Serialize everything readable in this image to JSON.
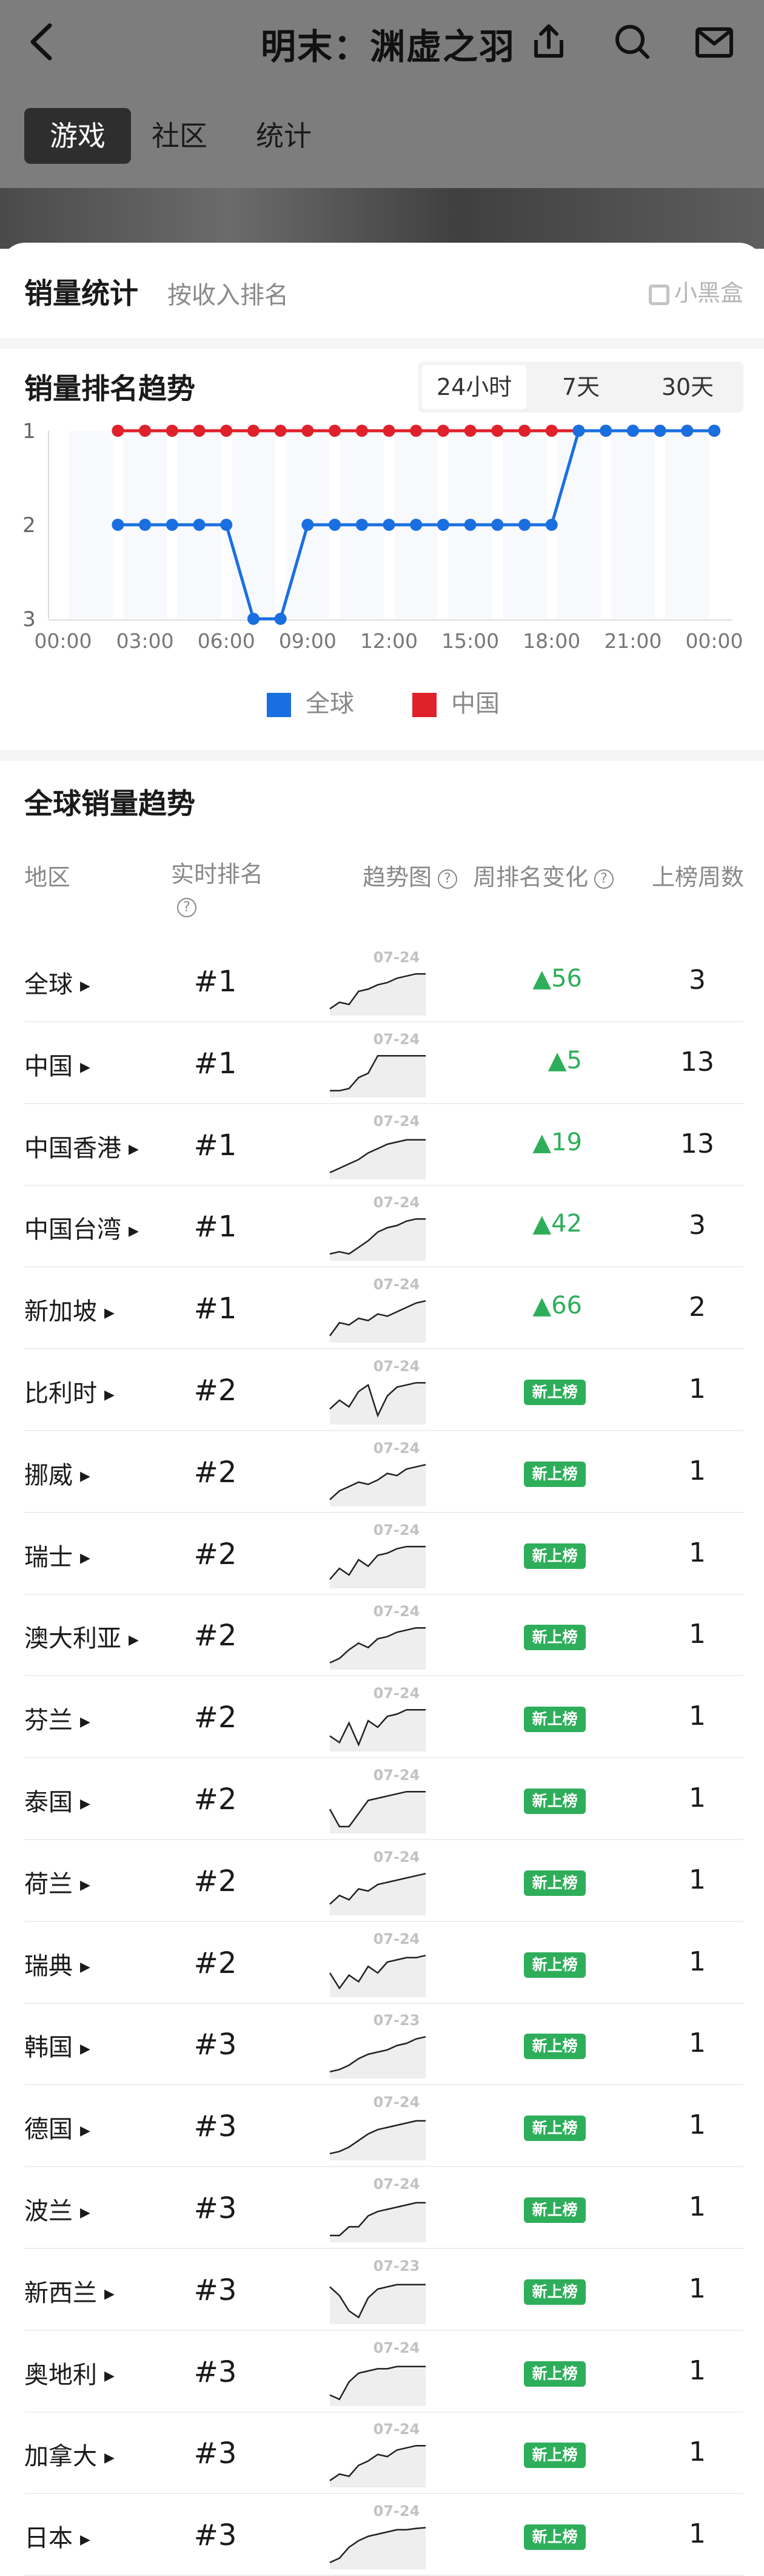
{
  "header": {
    "title": "明末：渊虚之羽",
    "tabs": [
      {
        "label": "游戏"
      },
      {
        "label": "社区"
      },
      {
        "label": "统计"
      }
    ]
  },
  "sales": {
    "title": "销量统计",
    "subtitle": "按收入排名",
    "brand": "小黑盒"
  },
  "trend": {
    "title": "销量排名趋势",
    "ranges": [
      "24小时",
      "7天",
      "30天"
    ],
    "selected": "24小时"
  },
  "chart_data": {
    "type": "line",
    "x": [
      "00:00",
      "01:00",
      "02:00",
      "03:00",
      "04:00",
      "05:00",
      "06:00",
      "07:00",
      "08:00",
      "09:00",
      "10:00",
      "11:00",
      "12:00",
      "13:00",
      "14:00",
      "15:00",
      "16:00",
      "17:00",
      "18:00",
      "19:00",
      "20:00",
      "21:00",
      "22:00",
      "23:00",
      "00:00"
    ],
    "xticks": [
      "00:00",
      "03:00",
      "06:00",
      "09:00",
      "12:00",
      "15:00",
      "18:00",
      "21:00",
      "00:00"
    ],
    "yticks": [
      "1",
      "2",
      "3"
    ],
    "ylim": [
      1,
      3
    ],
    "y_inverted": true,
    "series": [
      {
        "name": "全球",
        "color": "#1a6fe0",
        "values": [
          null,
          null,
          2,
          2,
          2,
          2,
          2,
          3,
          3,
          2,
          2,
          2,
          2,
          2,
          2,
          2,
          2,
          2,
          2,
          1,
          1,
          1,
          1,
          1,
          1
        ]
      },
      {
        "name": "中国",
        "color": "#e0202a",
        "values": [
          null,
          null,
          1,
          1,
          1,
          1,
          1,
          1,
          1,
          1,
          1,
          1,
          1,
          1,
          1,
          1,
          1,
          1,
          1,
          1,
          1,
          1,
          1,
          1,
          1
        ]
      }
    ],
    "grid": false,
    "legend": "bottom-center"
  },
  "global": {
    "title": "全球销量趋势",
    "headers": {
      "region": "地区",
      "rank": "实时排名",
      "trend": "趋势图",
      "change": "周排名变化",
      "weeks": "上榜周数"
    },
    "new_label": "新上榜",
    "rows": [
      {
        "region": "全球",
        "rank": "#1",
        "date": "07-24",
        "change": "▲56",
        "weeks": "3",
        "new": false
      },
      {
        "region": "中国",
        "rank": "#1",
        "date": "07-24",
        "change": "▲5",
        "weeks": "13",
        "new": false
      },
      {
        "region": "中国香港",
        "rank": "#1",
        "date": "07-24",
        "change": "▲19",
        "weeks": "13",
        "new": false
      },
      {
        "region": "中国台湾",
        "rank": "#1",
        "date": "07-24",
        "change": "▲42",
        "weeks": "3",
        "new": false
      },
      {
        "region": "新加坡",
        "rank": "#1",
        "date": "07-24",
        "change": "▲66",
        "weeks": "2",
        "new": false
      },
      {
        "region": "比利时",
        "rank": "#2",
        "date": "07-24",
        "change": "",
        "weeks": "1",
        "new": true
      },
      {
        "region": "挪威",
        "rank": "#2",
        "date": "07-24",
        "change": "",
        "weeks": "1",
        "new": true
      },
      {
        "region": "瑞士",
        "rank": "#2",
        "date": "07-24",
        "change": "",
        "weeks": "1",
        "new": true
      },
      {
        "region": "澳大利亚",
        "rank": "#2",
        "date": "07-24",
        "change": "",
        "weeks": "1",
        "new": true
      },
      {
        "region": "芬兰",
        "rank": "#2",
        "date": "07-24",
        "change": "",
        "weeks": "1",
        "new": true
      },
      {
        "region": "泰国",
        "rank": "#2",
        "date": "07-24",
        "change": "",
        "weeks": "1",
        "new": true
      },
      {
        "region": "荷兰",
        "rank": "#2",
        "date": "07-24",
        "change": "",
        "weeks": "1",
        "new": true
      },
      {
        "region": "瑞典",
        "rank": "#2",
        "date": "07-24",
        "change": "",
        "weeks": "1",
        "new": true
      },
      {
        "region": "韩国",
        "rank": "#3",
        "date": "07-23",
        "change": "",
        "weeks": "1",
        "new": true
      },
      {
        "region": "德国",
        "rank": "#3",
        "date": "07-24",
        "change": "",
        "weeks": "1",
        "new": true
      },
      {
        "region": "波兰",
        "rank": "#3",
        "date": "07-24",
        "change": "",
        "weeks": "1",
        "new": true
      },
      {
        "region": "新西兰",
        "rank": "#3",
        "date": "07-23",
        "change": "",
        "weeks": "1",
        "new": true
      },
      {
        "region": "奥地利",
        "rank": "#3",
        "date": "07-24",
        "change": "",
        "weeks": "1",
        "new": true
      },
      {
        "region": "加拿大",
        "rank": "#3",
        "date": "07-24",
        "change": "",
        "weeks": "1",
        "new": true
      },
      {
        "region": "日本",
        "rank": "#3",
        "date": "07-24",
        "change": "",
        "weeks": "1",
        "new": true
      }
    ]
  }
}
